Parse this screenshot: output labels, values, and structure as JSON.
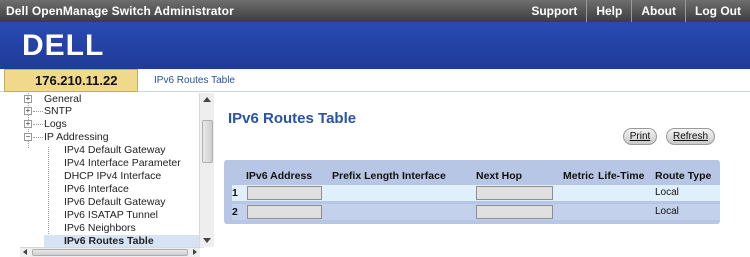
{
  "header": {
    "app_title": "Dell OpenManage Switch Administrator",
    "nav": [
      "Support",
      "Help",
      "About",
      "Log Out"
    ]
  },
  "brand": {
    "logo": "DELL"
  },
  "ipbar": {
    "ip": "176.210.11.22",
    "breadcrumb": "IPv6 Routes Table"
  },
  "sidebar": {
    "items": [
      {
        "label": "General",
        "expander": "+"
      },
      {
        "label": "SNTP",
        "expander": "+"
      },
      {
        "label": "Logs",
        "expander": "+"
      },
      {
        "label": "IP Addressing",
        "expander": "−"
      },
      {
        "label": "IPv4 Default Gateway"
      },
      {
        "label": "IPv4 Interface Parameter"
      },
      {
        "label": "DHCP IPv4 Interface"
      },
      {
        "label": "IPv6 Interface"
      },
      {
        "label": "IPv6 Default Gateway"
      },
      {
        "label": "IPv6 ISATAP Tunnel"
      },
      {
        "label": "IPv6 Neighbors"
      },
      {
        "label": "IPv6 Routes Table",
        "selected": true
      }
    ]
  },
  "main": {
    "title": "IPv6 Routes Table",
    "buttons": {
      "print": "Print",
      "refresh": "Refresh"
    },
    "table": {
      "columns": [
        "IPv6 Address",
        "Prefix Length Interface",
        "Next Hop",
        "Metric",
        "Life-Time",
        "Route Type"
      ],
      "rows": [
        {
          "num": "1",
          "address": "",
          "next_hop": "",
          "route_type": "Local"
        },
        {
          "num": "2",
          "address": "",
          "next_hop": "",
          "route_type": "Local"
        }
      ]
    }
  }
}
